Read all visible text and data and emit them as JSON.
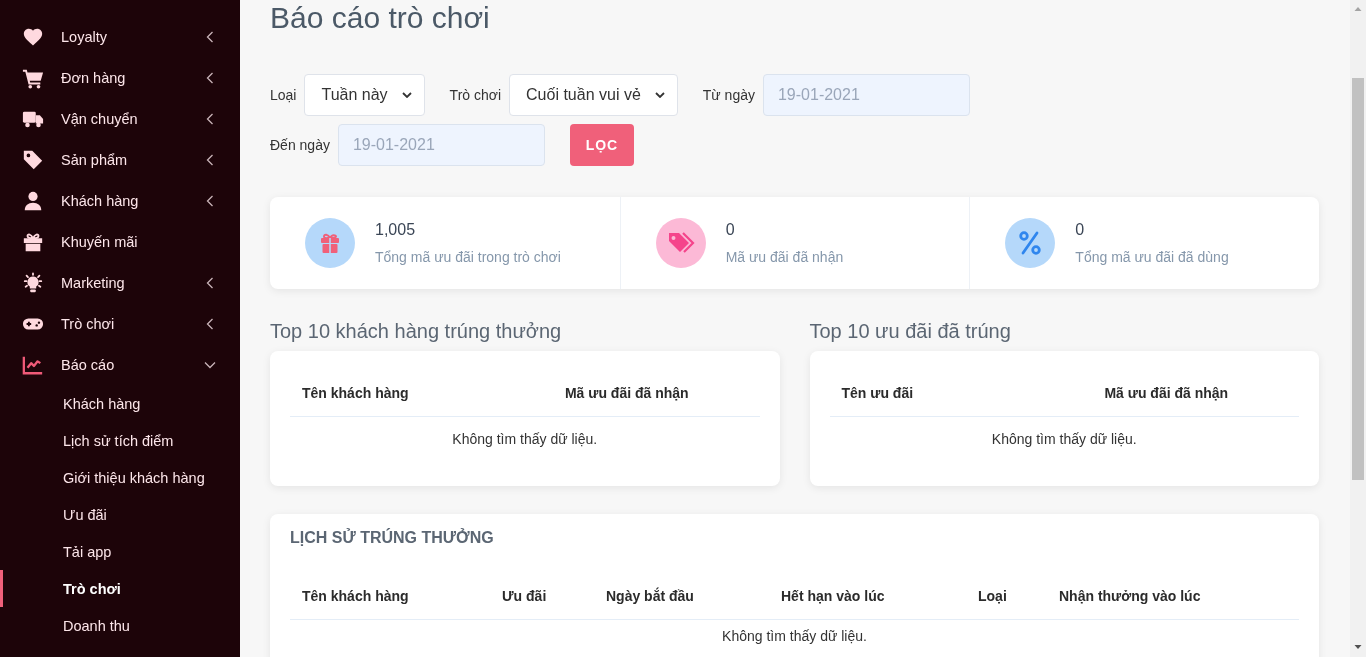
{
  "sidebar": {
    "items": [
      {
        "label": "Loyalty",
        "submenu": true,
        "expanded": false,
        "active": false
      },
      {
        "label": "Đơn hàng",
        "submenu": true,
        "expanded": false,
        "active": false
      },
      {
        "label": "Vận chuyển",
        "submenu": true,
        "expanded": false,
        "active": false
      },
      {
        "label": "Sản phẩm",
        "submenu": true,
        "expanded": false,
        "active": false
      },
      {
        "label": "Khách hàng",
        "submenu": true,
        "expanded": false,
        "active": false
      },
      {
        "label": "Khuyến mãi",
        "submenu": false,
        "active": false
      },
      {
        "label": "Marketing",
        "submenu": true,
        "expanded": false,
        "active": false
      },
      {
        "label": "Trò chơi",
        "submenu": true,
        "expanded": false,
        "active": false
      },
      {
        "label": "Báo cáo",
        "submenu": true,
        "expanded": true,
        "active": true,
        "children": [
          {
            "label": "Khách hàng",
            "selected": false
          },
          {
            "label": "Lịch sử tích điểm",
            "selected": false
          },
          {
            "label": "Giới thiệu khách hàng",
            "selected": false
          },
          {
            "label": "Ưu đãi",
            "selected": false
          },
          {
            "label": "Tải app",
            "selected": false
          },
          {
            "label": "Trò chơi",
            "selected": true
          },
          {
            "label": "Doanh thu",
            "selected": false
          }
        ]
      }
    ]
  },
  "page_title": "Báo cáo trò chơi",
  "filters": [
    {
      "kind": "select",
      "label": "Loại",
      "value": "Tuần này"
    },
    {
      "kind": "select",
      "label": "Trò chơi",
      "value": "Cuối tuần vui vẻ"
    },
    {
      "kind": "date",
      "label": "Từ ngày",
      "value": "19-01-2021",
      "disabled": true
    },
    {
      "kind": "date",
      "label": "Đến ngày",
      "value": "19-01-2021",
      "disabled": true
    }
  ],
  "filter_button": "LỌC",
  "stats": [
    {
      "value": "1,005",
      "label": "Tổng mã ưu đãi trong trò chơi"
    },
    {
      "value": "0",
      "label": "Mã ưu đãi đã nhận"
    },
    {
      "value": "0",
      "label": "Tổng mã ưu đãi đã dùng"
    }
  ],
  "tables": [
    {
      "title": "Top 10 khách hàng trúng thưởng",
      "columns": [
        "Tên khách hàng",
        "Mã ưu đãi đã nhận"
      ],
      "empty_text": "Không tìm thấy dữ liệu."
    },
    {
      "title": "Top 10 ưu đãi đã trúng",
      "columns": [
        "Tên ưu đãi",
        "Mã ưu đãi đã nhận"
      ],
      "empty_text": "Không tìm thấy dữ liệu."
    }
  ],
  "history": {
    "title": "LỊCH SỬ TRÚNG THƯỞNG",
    "columns": [
      "Tên khách hàng",
      "Ưu đãi",
      "Ngày bắt đầu",
      "Hết hạn vào lúc",
      "Loại",
      "Nhận thưởng vào lúc"
    ],
    "empty_text": "Không tìm thấy dữ liệu."
  }
}
